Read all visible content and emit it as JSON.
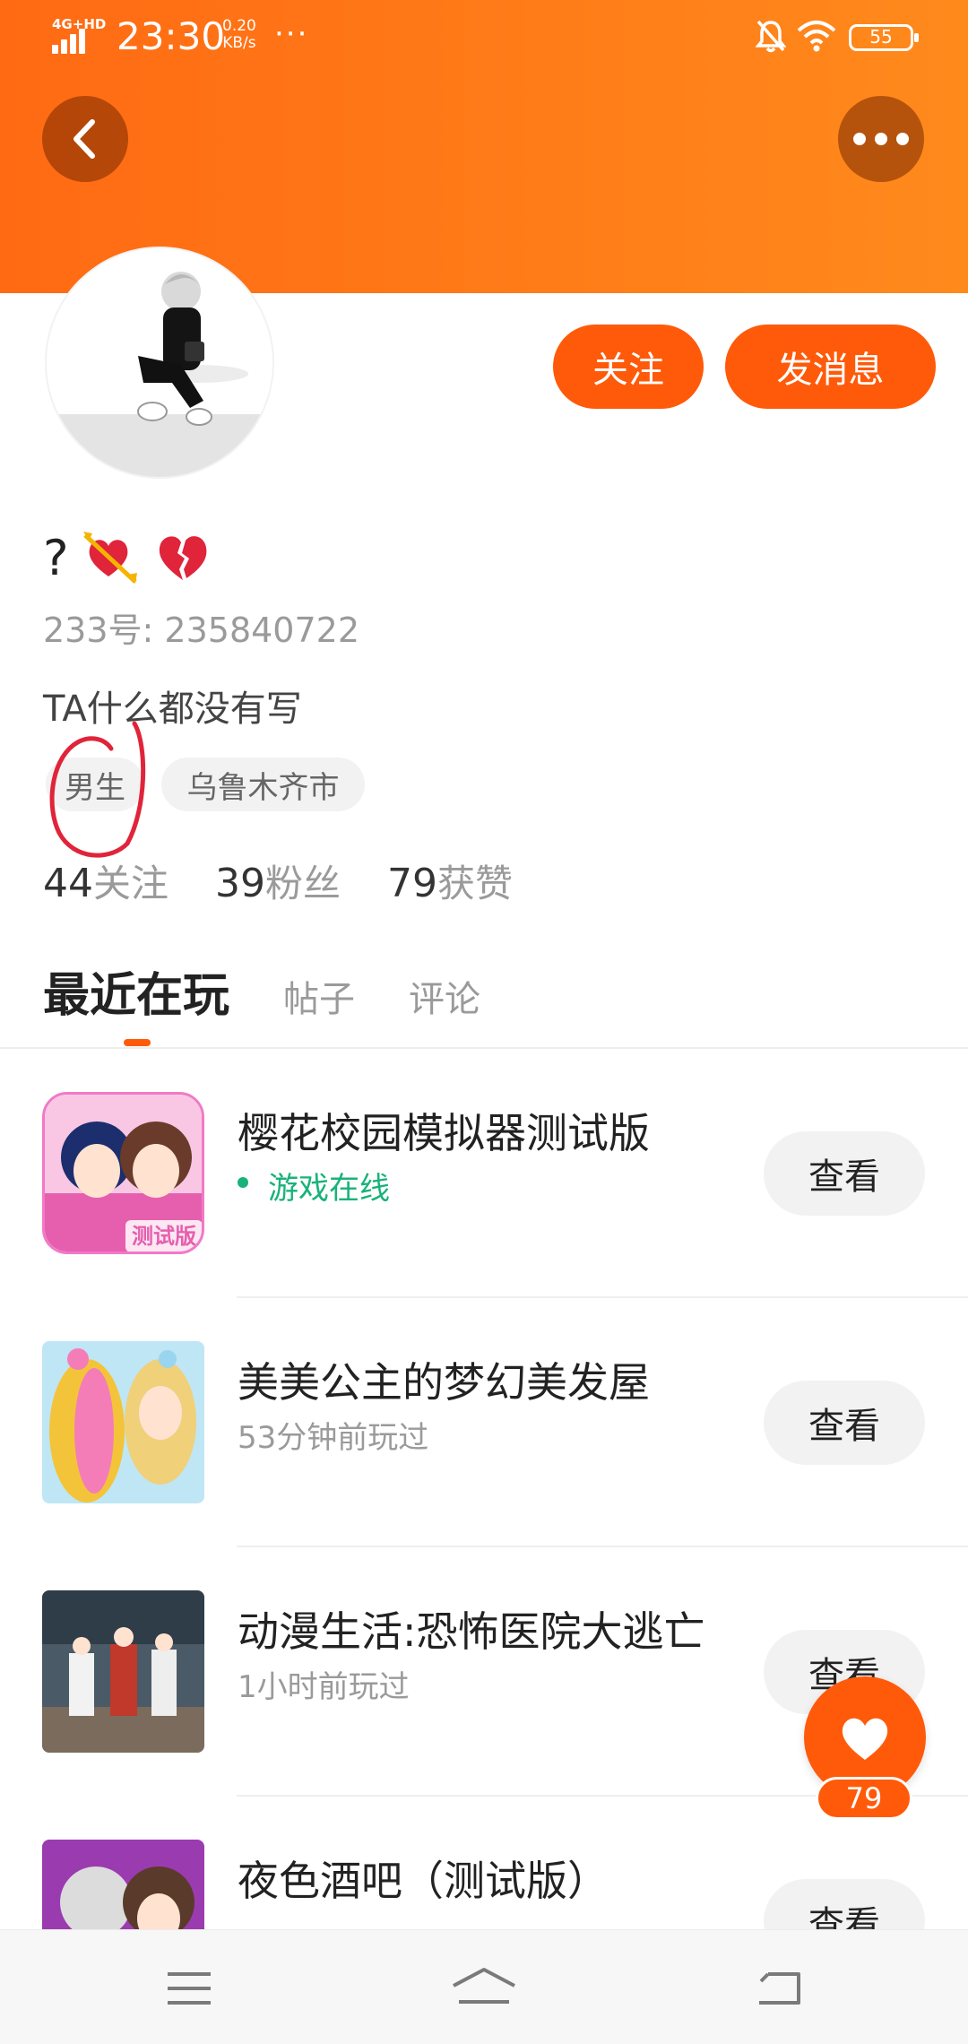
{
  "status_bar": {
    "network": "4G+HD",
    "time": "23:30",
    "speed_value": "0.20",
    "speed_unit": "KB/s",
    "more": "···",
    "battery": "55"
  },
  "header": {
    "back_icon": "chevron-left-icon",
    "more_icon": "more-horizontal-icon"
  },
  "profile": {
    "nickname_prefix": "?",
    "id_label": "233号: 235840722",
    "bio": "TA什么都没有写",
    "tags": [
      "男生",
      "乌鲁木齐市"
    ],
    "follow_label": "关注",
    "message_label": "发消息"
  },
  "stats": [
    {
      "num": "44",
      "label": "关注"
    },
    {
      "num": "39",
      "label": "粉丝"
    },
    {
      "num": "79",
      "label": "获赞"
    }
  ],
  "tabs": [
    {
      "label": "最近在玩",
      "active": true
    },
    {
      "label": "帖子",
      "active": false
    },
    {
      "label": "评论",
      "active": false
    }
  ],
  "games": [
    {
      "title": "樱花校园模拟器测试版",
      "sub": "游戏在线",
      "online": true,
      "button": "查看"
    },
    {
      "title": "美美公主的梦幻美发屋",
      "sub": "53分钟前玩过",
      "online": false,
      "button": "查看"
    },
    {
      "title": "动漫生活:恐怖医院大逃亡",
      "sub": "1小时前玩过",
      "online": false,
      "button": "查看"
    },
    {
      "title": "夜色酒吧（测试版）",
      "sub": "",
      "online": false,
      "button": "查看"
    }
  ],
  "like": {
    "count": "79"
  },
  "colors": {
    "accent": "#ff5a0a",
    "online": "#18b27a",
    "banner_start": "#ff6a13",
    "banner_end": "#ff8a1c"
  }
}
